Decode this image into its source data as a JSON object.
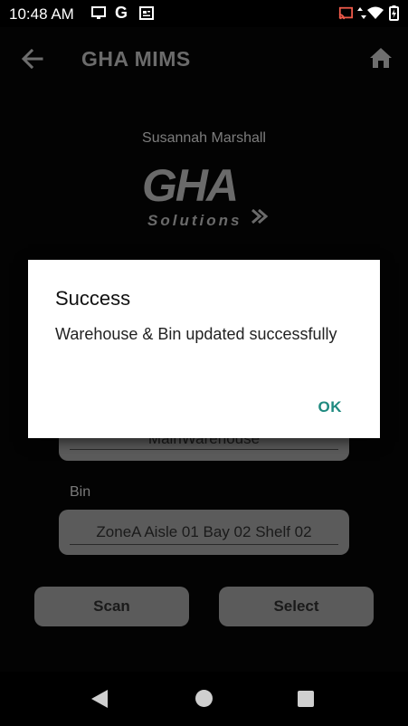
{
  "status_bar": {
    "time": "10:48 AM",
    "left_icons": [
      "cast-screen-icon",
      "google-icon",
      "news-icon"
    ],
    "google_letter": "G",
    "right_icons": [
      "screen-mirror-icon",
      "data-arrows-icon",
      "wifi-icon",
      "battery-charging-icon"
    ]
  },
  "app_bar": {
    "title": "GHA MIMS",
    "back_icon": "arrow-left-icon",
    "home_icon": "home-icon"
  },
  "user": {
    "name": "Susannah Marshall"
  },
  "logo": {
    "main": "GHA",
    "sub": "Solutions"
  },
  "form": {
    "warehouse_value": "MainWarehouse",
    "bin_label": "Bin",
    "bin_value": "ZoneA Aisle 01 Bay 02 Shelf 02",
    "scan_button": "Scan",
    "select_button": "Select"
  },
  "dialog": {
    "title": "Success",
    "message": "Warehouse & Bin updated successfully",
    "ok_button": "OK"
  },
  "colors": {
    "background": "#030303",
    "dialog_bg": "#ffffff",
    "accent_ok": "#1f8a80",
    "field_bg": "#5b5b5b"
  },
  "nav_bar": {
    "icons": [
      "nav-back-icon",
      "nav-home-icon",
      "nav-recents-icon"
    ]
  }
}
